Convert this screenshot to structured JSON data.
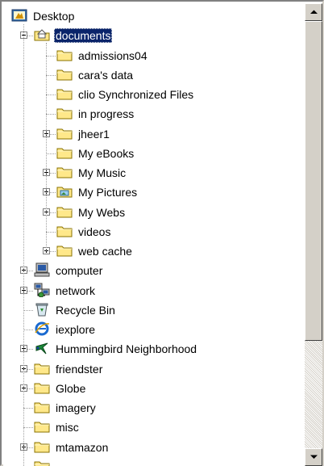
{
  "tree": {
    "root": {
      "label": "Desktop",
      "icon": "desktop-icon"
    },
    "documents": {
      "label": "documents",
      "icon": "my-documents-folder-icon",
      "expander": "minus"
    },
    "documents_children": [
      {
        "label": "admissions04",
        "icon": "folder-icon",
        "expander": "none"
      },
      {
        "label": "cara's data",
        "icon": "folder-icon",
        "expander": "none"
      },
      {
        "label": "clio Synchronized Files",
        "icon": "folder-icon",
        "expander": "none"
      },
      {
        "label": "in progress",
        "icon": "folder-icon",
        "expander": "none"
      },
      {
        "label": "jheer1",
        "icon": "folder-icon",
        "expander": "plus"
      },
      {
        "label": "My eBooks",
        "icon": "folder-icon",
        "expander": "none"
      },
      {
        "label": "My Music",
        "icon": "folder-icon",
        "expander": "plus"
      },
      {
        "label": "My Pictures",
        "icon": "pictures-folder-icon",
        "expander": "plus"
      },
      {
        "label": "My Webs",
        "icon": "folder-icon",
        "expander": "plus"
      },
      {
        "label": "videos",
        "icon": "folder-icon",
        "expander": "none"
      },
      {
        "label": "web cache",
        "icon": "folder-icon",
        "expander": "plus"
      }
    ],
    "desktop_children": [
      {
        "label": "computer",
        "icon": "computer-icon",
        "expander": "plus"
      },
      {
        "label": "network",
        "icon": "network-icon",
        "expander": "plus"
      },
      {
        "label": "Recycle Bin",
        "icon": "recycle-bin-icon",
        "expander": "none"
      },
      {
        "label": "iexplore",
        "icon": "internet-explorer-icon",
        "expander": "none"
      },
      {
        "label": "Hummingbird Neighborhood",
        "icon": "hummingbird-icon",
        "expander": "plus"
      },
      {
        "label": "friendster",
        "icon": "folder-icon",
        "expander": "plus"
      },
      {
        "label": "Globe",
        "icon": "folder-icon",
        "expander": "plus"
      },
      {
        "label": "imagery",
        "icon": "folder-icon",
        "expander": "none"
      },
      {
        "label": "misc",
        "icon": "folder-icon",
        "expander": "none"
      },
      {
        "label": "mtamazon",
        "icon": "folder-icon",
        "expander": "plus"
      }
    ]
  },
  "scrollbar": {
    "up_icon": "scroll-up-arrow-icon",
    "down_icon": "scroll-down-arrow-icon"
  },
  "colors": {
    "selection": "#0a246a",
    "folder_fill": "#ffe88a",
    "folder_outline": "#8a7200"
  }
}
